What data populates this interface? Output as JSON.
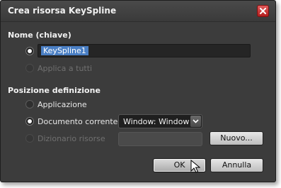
{
  "dialog": {
    "title": "Crea risorsa KeySpline",
    "close_icon": "close-icon"
  },
  "name_section": {
    "label": "Nome (chiave)",
    "key_value": "KeySpline1",
    "apply_all_label": "Applica a tutti"
  },
  "definition_section": {
    "label": "Posizione definizione",
    "options": [
      {
        "label": "Applicazione",
        "selected": false,
        "enabled": true
      },
      {
        "label": "Documento corrente",
        "selected": true,
        "enabled": true
      },
      {
        "label": "Dizionario risorse",
        "selected": false,
        "enabled": false
      }
    ],
    "document_selection": "Window: Window",
    "new_button_label": "Nuovo..."
  },
  "footer": {
    "ok_label": "OK",
    "cancel_label": "Annulla"
  },
  "colors": {
    "background": "#3c3c3c",
    "selection": "#4a7fc4",
    "close_button": "#c82828"
  }
}
